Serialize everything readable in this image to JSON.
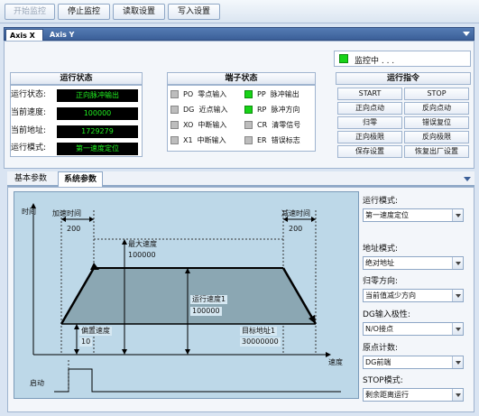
{
  "toolbar": {
    "start_monitor": "开始监控",
    "stop_monitor": "停止监控",
    "read_settings": "读取设置",
    "write_settings": "写入设置"
  },
  "axis_tabs": [
    "Axis X",
    "Axis Y"
  ],
  "monitor": {
    "status": "监控中 . . ."
  },
  "run_status": {
    "title": "运行状态",
    "rows": [
      {
        "label": "运行状态:",
        "value": "正向脉冲输出"
      },
      {
        "label": "当前速度:",
        "value": "100000"
      },
      {
        "label": "当前地址:",
        "value": "1729279"
      },
      {
        "label": "运行模式:",
        "value": "第一速度定位"
      }
    ]
  },
  "terminal_status": {
    "title": "端子状态",
    "items": [
      {
        "code": "PO",
        "label": "零点输入",
        "on": false
      },
      {
        "code": "PP",
        "label": "脉冲输出",
        "on": true
      },
      {
        "code": "DG",
        "label": "近点输入",
        "on": false
      },
      {
        "code": "RP",
        "label": "脉冲方向",
        "on": true
      },
      {
        "code": "XO",
        "label": "中断输入",
        "on": false
      },
      {
        "code": "CR",
        "label": "清零信号",
        "on": false
      },
      {
        "code": "X1",
        "label": "中断输入",
        "on": false
      },
      {
        "code": "ER",
        "label": "错误标志",
        "on": false
      }
    ]
  },
  "run_commands": {
    "title": "运行指令",
    "buttons": [
      "START",
      "STOP",
      "正向点动",
      "反向点动",
      "归零",
      "错误复位",
      "正向极限",
      "反向极限",
      "保存设置",
      "恢复出厂设置"
    ]
  },
  "sub_tabs": [
    "基本参数",
    "系统参数"
  ],
  "diagram": {
    "time_label": "时间",
    "accel_time_label": "加速时间",
    "decel_time_label": "减速时间",
    "accel_time": "200",
    "decel_time": "200",
    "max_speed_label": "最大速度",
    "max_speed": "100000",
    "run_speed_label": "运行速度1",
    "run_speed": "100000",
    "bias_speed_label": "偏置速度",
    "bias_speed": "10",
    "target_addr_label": "目标地址1",
    "target_addr": "30000000",
    "speed_axis": "速度",
    "start_label": "启动"
  },
  "settings": {
    "run_mode": {
      "label": "运行模式:",
      "value": "第一速度定位"
    },
    "addr_mode": {
      "label": "地址模式:",
      "value": "绝对地址"
    },
    "home_dir": {
      "label": "归零方向:",
      "value": "当前值减少方向"
    },
    "dg_polarity": {
      "label": "DG输入极性:",
      "value": "N/O接点"
    },
    "origin_count": {
      "label": "原点计数:",
      "value": "DG前端"
    },
    "stop_mode": {
      "label": "STOP模式:",
      "value": "剩余距离运行"
    }
  }
}
